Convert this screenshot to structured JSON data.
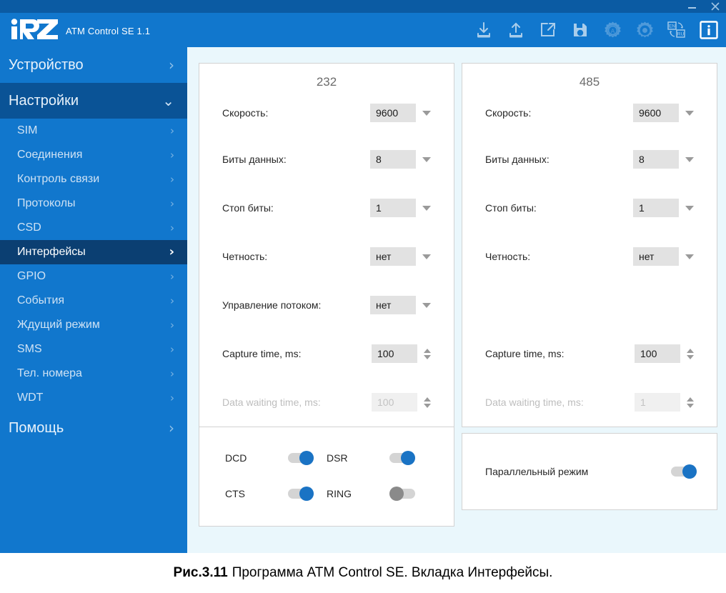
{
  "window": {
    "minimize_label": "—",
    "close_label": "✕"
  },
  "header": {
    "logo_text": "iRZ",
    "app_title": "ATM Control SE 1.1",
    "toolbar": [
      {
        "name": "download-icon",
        "title": "Download"
      },
      {
        "name": "upload-icon",
        "title": "Upload"
      },
      {
        "name": "open-external-icon",
        "title": "Open"
      },
      {
        "name": "save-icon",
        "title": "Save"
      },
      {
        "name": "auto-settings-gear-icon",
        "title": "Auto"
      },
      {
        "name": "settings-gear-icon",
        "title": "Settings"
      },
      {
        "name": "language-toggle-icon",
        "title": "EN / RU",
        "from": "EN",
        "to": "RU"
      },
      {
        "name": "info-icon",
        "title": "Info",
        "glyph": "i"
      }
    ]
  },
  "sidebar": {
    "groups": [
      {
        "label": "Устройство",
        "state": "collapsed",
        "chevron": "›"
      },
      {
        "label": "Настройки",
        "state": "expanded",
        "chevron": "⌄"
      }
    ],
    "items": [
      {
        "label": "SIM",
        "active": false
      },
      {
        "label": "Соединения",
        "active": false
      },
      {
        "label": "Контроль связи",
        "active": false
      },
      {
        "label": "Протоколы",
        "active": false
      },
      {
        "label": "CSD",
        "active": false
      },
      {
        "label": "Интерфейсы",
        "active": true
      },
      {
        "label": "GPIO",
        "active": false
      },
      {
        "label": "События",
        "active": false
      },
      {
        "label": "Ждущий режим",
        "active": false
      },
      {
        "label": "SMS",
        "active": false
      },
      {
        "label": "Тел. номера",
        "active": false
      },
      {
        "label": "WDT",
        "active": false
      }
    ],
    "help": {
      "label": "Помощь",
      "chevron": "›"
    }
  },
  "panel_232": {
    "title": "232",
    "fields": [
      {
        "label": "Скорость:",
        "value": "9600",
        "control": "dropdown",
        "disabled": false
      },
      {
        "label": "Биты данных:",
        "value": "8",
        "control": "dropdown",
        "disabled": false
      },
      {
        "label": "Стоп биты:",
        "value": "1",
        "control": "dropdown",
        "disabled": false
      },
      {
        "label": "Четность:",
        "value": "нет",
        "control": "dropdown",
        "disabled": false
      },
      {
        "label": "Управление потоком:",
        "value": "нет",
        "control": "dropdown",
        "disabled": false
      },
      {
        "label": "Capture time, ms:",
        "value": "100",
        "control": "spinner",
        "disabled": false
      },
      {
        "label": "Data waiting time, ms:",
        "value": "100",
        "control": "spinner",
        "disabled": true
      }
    ],
    "signals": [
      {
        "label": "DCD",
        "on": true
      },
      {
        "label": "DSR",
        "on": true
      },
      {
        "label": "CTS",
        "on": true
      },
      {
        "label": "RING",
        "on": false
      }
    ]
  },
  "panel_485": {
    "title": "485",
    "fields": [
      {
        "label": "Скорость:",
        "value": "9600",
        "control": "dropdown",
        "disabled": false
      },
      {
        "label": "Биты данных:",
        "value": "8",
        "control": "dropdown",
        "disabled": false
      },
      {
        "label": "Стоп биты:",
        "value": "1",
        "control": "dropdown",
        "disabled": false
      },
      {
        "label": "Четность:",
        "value": "нет",
        "control": "dropdown",
        "disabled": false
      },
      {
        "label": "",
        "value": "",
        "control": "spacer",
        "disabled": false
      },
      {
        "label": "Capture time, ms:",
        "value": "100",
        "control": "spinner",
        "disabled": false
      },
      {
        "label": "Data waiting time, ms:",
        "value": "1",
        "control": "spinner",
        "disabled": true
      }
    ],
    "parallel": {
      "label": "Параллельный режим",
      "on": true
    }
  },
  "caption": {
    "figure": "Рис.3.11",
    "text": "Программа ATM Control SE. Вкладка Интерфейсы."
  },
  "colors": {
    "brand_blue": "#1177cd",
    "title_blue": "#0b5ba3",
    "active_nav": "#0b3f72",
    "toggle_on": "#1a73c4",
    "toggle_off": "#8a8a8a",
    "content_bg": "#eaf7fc"
  }
}
